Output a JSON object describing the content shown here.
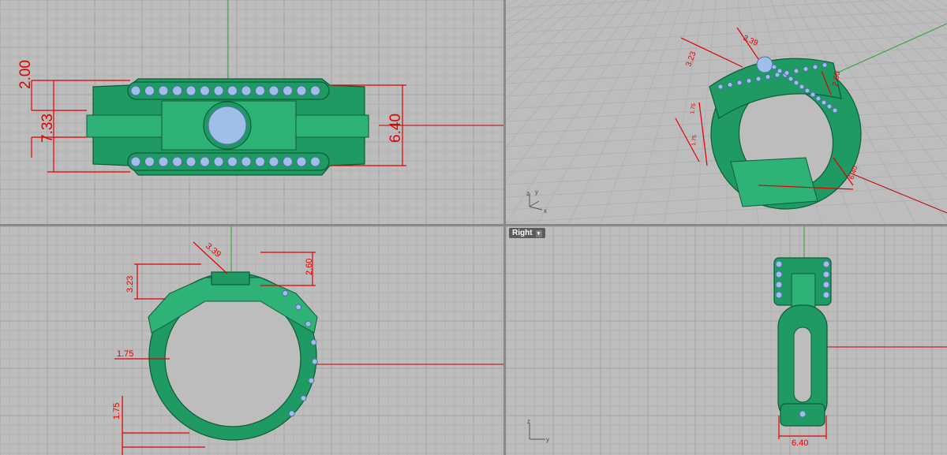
{
  "viewports": {
    "top": {
      "dimensions": [
        "2.00",
        "7.33",
        "6.40"
      ]
    },
    "perspective": {
      "dimensions": [
        "3.39",
        "3.23",
        "2.60",
        "1.75",
        "1.75",
        "6.40"
      ],
      "axes": [
        "z",
        "y",
        "x"
      ]
    },
    "front": {
      "dimensions": [
        "3.39",
        "3.23",
        "2.60",
        "1.75",
        "1.75"
      ]
    },
    "right": {
      "label": "Right",
      "dimensions": [
        "6.40"
      ],
      "axes": [
        "z",
        "y"
      ]
    }
  },
  "colors": {
    "ring": "#1f9a63",
    "stone": "#9fbfe8",
    "dimension": "#e00000",
    "grid_background": "#bdbdbd"
  }
}
